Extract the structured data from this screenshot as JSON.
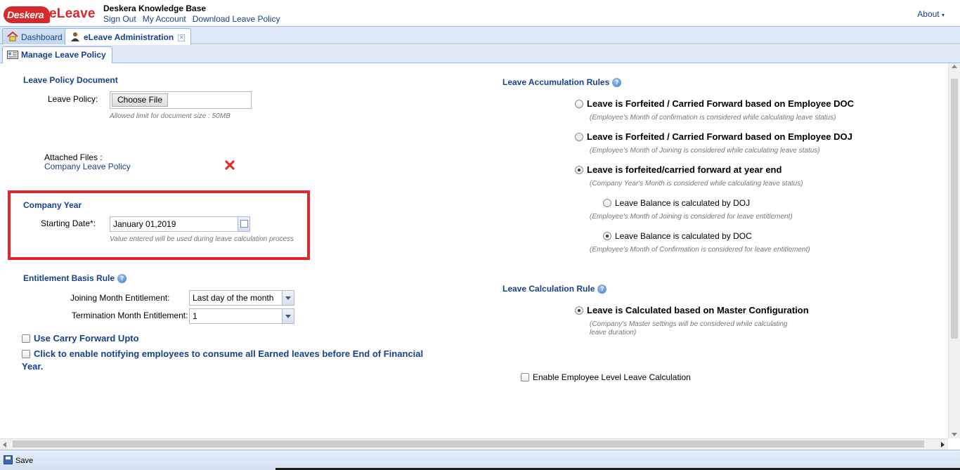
{
  "header": {
    "logo_badge": "Deskera",
    "logo_product": "eLeave",
    "kb_title": "Deskera Knowledge Base",
    "links": [
      "Sign Out",
      "My Account",
      "Download Leave Policy"
    ],
    "about": "About"
  },
  "tabs": [
    {
      "label": "Dashboard",
      "icon": "home-icon"
    },
    {
      "label": "eLeave Administration",
      "icon": "admin-user-icon",
      "active": true
    }
  ],
  "subtab": {
    "label": "Manage Leave Policy",
    "icon": "policy-icon"
  },
  "left": {
    "policy_doc": {
      "title": "Leave Policy Document",
      "label": "Leave Policy:",
      "button": "Choose File",
      "hint": "Allowed limit for document size : 50MB",
      "attached_label": "Attached Files :",
      "attached_file": "Company Leave Policy"
    },
    "company_year": {
      "title": "Company Year",
      "label": "Starting Date*:",
      "value": "January 01,2019",
      "hint": "Value entered will be used during leave calculation process"
    },
    "entitlement": {
      "title": "Entitlement Basis Rule",
      "joining_label": "Joining Month Entitlement:",
      "joining_value": "Last day of the month",
      "termination_label": "Termination Month Entitlement:",
      "termination_value": "1"
    },
    "carry_forward": "Use Carry Forward Upto",
    "notify_line1": "Click to enable notifying employees to consume all Earned leaves before End of Financial",
    "notify_line2": "Year."
  },
  "right": {
    "accumulation": {
      "title": "Leave Accumulation Rules",
      "options": [
        {
          "label": "Leave is Forfeited / Carried Forward based on Employee DOC",
          "hint": "(Employee's Month of confirmation is considered while calculating leave status)",
          "selected": false
        },
        {
          "label": "Leave is Forfeited / Carried Forward based on Employee DOJ",
          "hint": "(Employee's Month of Joining is considered while calculating leave status)",
          "selected": false
        },
        {
          "label": "Leave is forfeited/carried forward at year end",
          "hint": "(Company Year's Month is considered while calculating leave status)",
          "selected": true
        }
      ],
      "sub_options": [
        {
          "label": "Leave Balance is calculated by DOJ",
          "hint": "(Employee's Month of Joining is considered for leave entitlement)",
          "selected": false
        },
        {
          "label": "Leave Balance is calculated by DOC",
          "hint": "(Employee's Month of Confirmation is considered for leave entitlement)",
          "selected": true
        }
      ]
    },
    "calculation": {
      "title": "Leave Calculation Rule",
      "option": "Leave is Calculated based on Master Configuration",
      "hint_line1": "(Company's Master settings will be considered while calculating",
      "hint_line2": "leave duration)"
    },
    "employee_level": "Enable Employee Level Leave Calculation"
  },
  "toolbar": {
    "save": "Save"
  },
  "colors": {
    "accent": "#15428b",
    "brand_red": "#d7292a",
    "highlight": "#e3242b"
  }
}
